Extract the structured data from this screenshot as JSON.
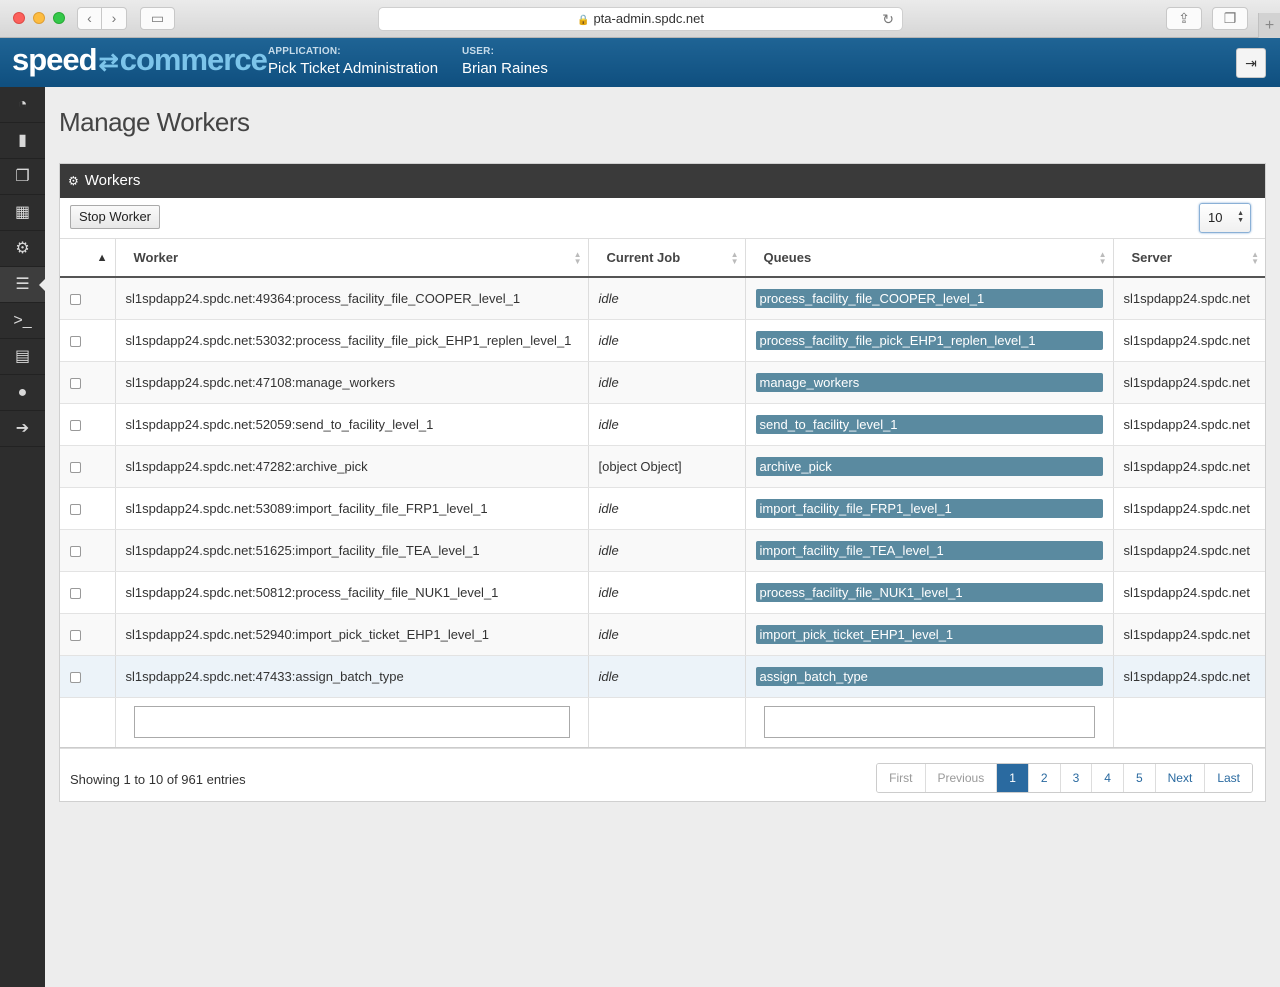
{
  "browser": {
    "url": "pta-admin.spdc.net"
  },
  "header": {
    "brand_left": "speed",
    "brand_right": "commerce",
    "application_key": "APPLICATION:",
    "application_value": "Pick Ticket Administration",
    "user_key": "USER:",
    "user_value": "Brian Raines"
  },
  "page": {
    "title": "Manage Workers"
  },
  "panel": {
    "title": "Workers",
    "stop_button": "Stop Worker",
    "page_length": "10"
  },
  "columns": {
    "worker": "Worker",
    "current_job": "Current Job",
    "queues": "Queues",
    "server": "Server"
  },
  "rows": [
    {
      "worker": "sl1spdapp24.spdc.net:49364:process_facility_file_COOPER_level_1",
      "job": "idle",
      "queue": "process_facility_file_COOPER_level_1",
      "server": "sl1spdapp24.spdc.net"
    },
    {
      "worker": "sl1spdapp24.spdc.net:53032:process_facility_file_pick_EHP1_replen_level_1",
      "job": "idle",
      "queue": "process_facility_file_pick_EHP1_replen_level_1",
      "server": "sl1spdapp24.spdc.net"
    },
    {
      "worker": "sl1spdapp24.spdc.net:47108:manage_workers",
      "job": "idle",
      "queue": "manage_workers",
      "server": "sl1spdapp24.spdc.net"
    },
    {
      "worker": "sl1spdapp24.spdc.net:52059:send_to_facility_level_1",
      "job": "idle",
      "queue": "send_to_facility_level_1",
      "server": "sl1spdapp24.spdc.net"
    },
    {
      "worker": "sl1spdapp24.spdc.net:47282:archive_pick",
      "job": "[object Object]",
      "queue": "archive_pick",
      "server": "sl1spdapp24.spdc.net"
    },
    {
      "worker": "sl1spdapp24.spdc.net:53089:import_facility_file_FRP1_level_1",
      "job": "idle",
      "queue": "import_facility_file_FRP1_level_1",
      "server": "sl1spdapp24.spdc.net"
    },
    {
      "worker": "sl1spdapp24.spdc.net:51625:import_facility_file_TEA_level_1",
      "job": "idle",
      "queue": "import_facility_file_TEA_level_1",
      "server": "sl1spdapp24.spdc.net"
    },
    {
      "worker": "sl1spdapp24.spdc.net:50812:process_facility_file_NUK1_level_1",
      "job": "idle",
      "queue": "process_facility_file_NUK1_level_1",
      "server": "sl1spdapp24.spdc.net"
    },
    {
      "worker": "sl1spdapp24.spdc.net:52940:import_pick_ticket_EHP1_level_1",
      "job": "idle",
      "queue": "import_pick_ticket_EHP1_level_1",
      "server": "sl1spdapp24.spdc.net"
    },
    {
      "worker": "sl1spdapp24.spdc.net:47433:assign_batch_type",
      "job": "idle",
      "queue": "assign_batch_type",
      "server": "sl1spdapp24.spdc.net"
    }
  ],
  "footer": {
    "info": "Showing 1 to 10 of 961 entries",
    "pager": {
      "first": "First",
      "previous": "Previous",
      "pages": [
        "1",
        "2",
        "3",
        "4",
        "5"
      ],
      "next": "Next",
      "last": "Last"
    }
  },
  "sidebar_icons": [
    "dashboard-icon",
    "file-icon",
    "files-icon",
    "building-icon",
    "gears-icon",
    "server-icon",
    "terminal-icon",
    "document-icon",
    "user-icon",
    "sign-out-icon"
  ],
  "colors": {
    "header_bg": "#0f4f7f",
    "queue_badge": "#5a8aa0",
    "active_page": "#2a6aa0",
    "panel_head": "#3a3a3a"
  }
}
